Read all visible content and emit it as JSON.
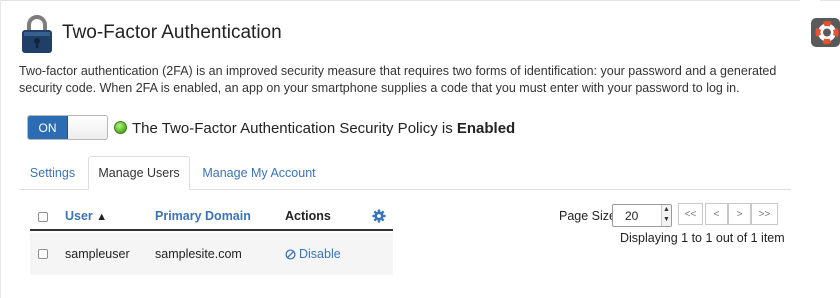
{
  "header": {
    "title": "Two-Factor Authentication"
  },
  "description": "Two-factor authentication (2FA) is an improved security measure that requires two forms of identification: your password and a generated security code. When 2FA is enabled, an app on your smartphone supplies a code that you must enter with your password to log in.",
  "policy": {
    "toggle_label": "ON",
    "status_text_prefix": "The Two-Factor Authentication Security Policy is",
    "status_value": "Enabled",
    "status_color": "#5fbf2e"
  },
  "tabs": [
    {
      "label": "Settings",
      "active": false
    },
    {
      "label": "Manage Users",
      "active": true
    },
    {
      "label": "Manage My Account",
      "active": false
    }
  ],
  "table": {
    "columns": {
      "user": "User",
      "sort_indicator": "▲",
      "domain": "Primary Domain",
      "actions": "Actions"
    },
    "rows": [
      {
        "user": "sampleuser",
        "domain": "samplesite.com",
        "action": "Disable"
      }
    ]
  },
  "pagination": {
    "page_size_label": "Page Size",
    "page_size_value": "20",
    "first": "<<",
    "prev": "<",
    "next": ">",
    "last": ">>",
    "info": "Displaying 1 to 1 out of 1 item"
  },
  "colors": {
    "accent": "#2b6cb3",
    "link": "#3a74b6"
  }
}
